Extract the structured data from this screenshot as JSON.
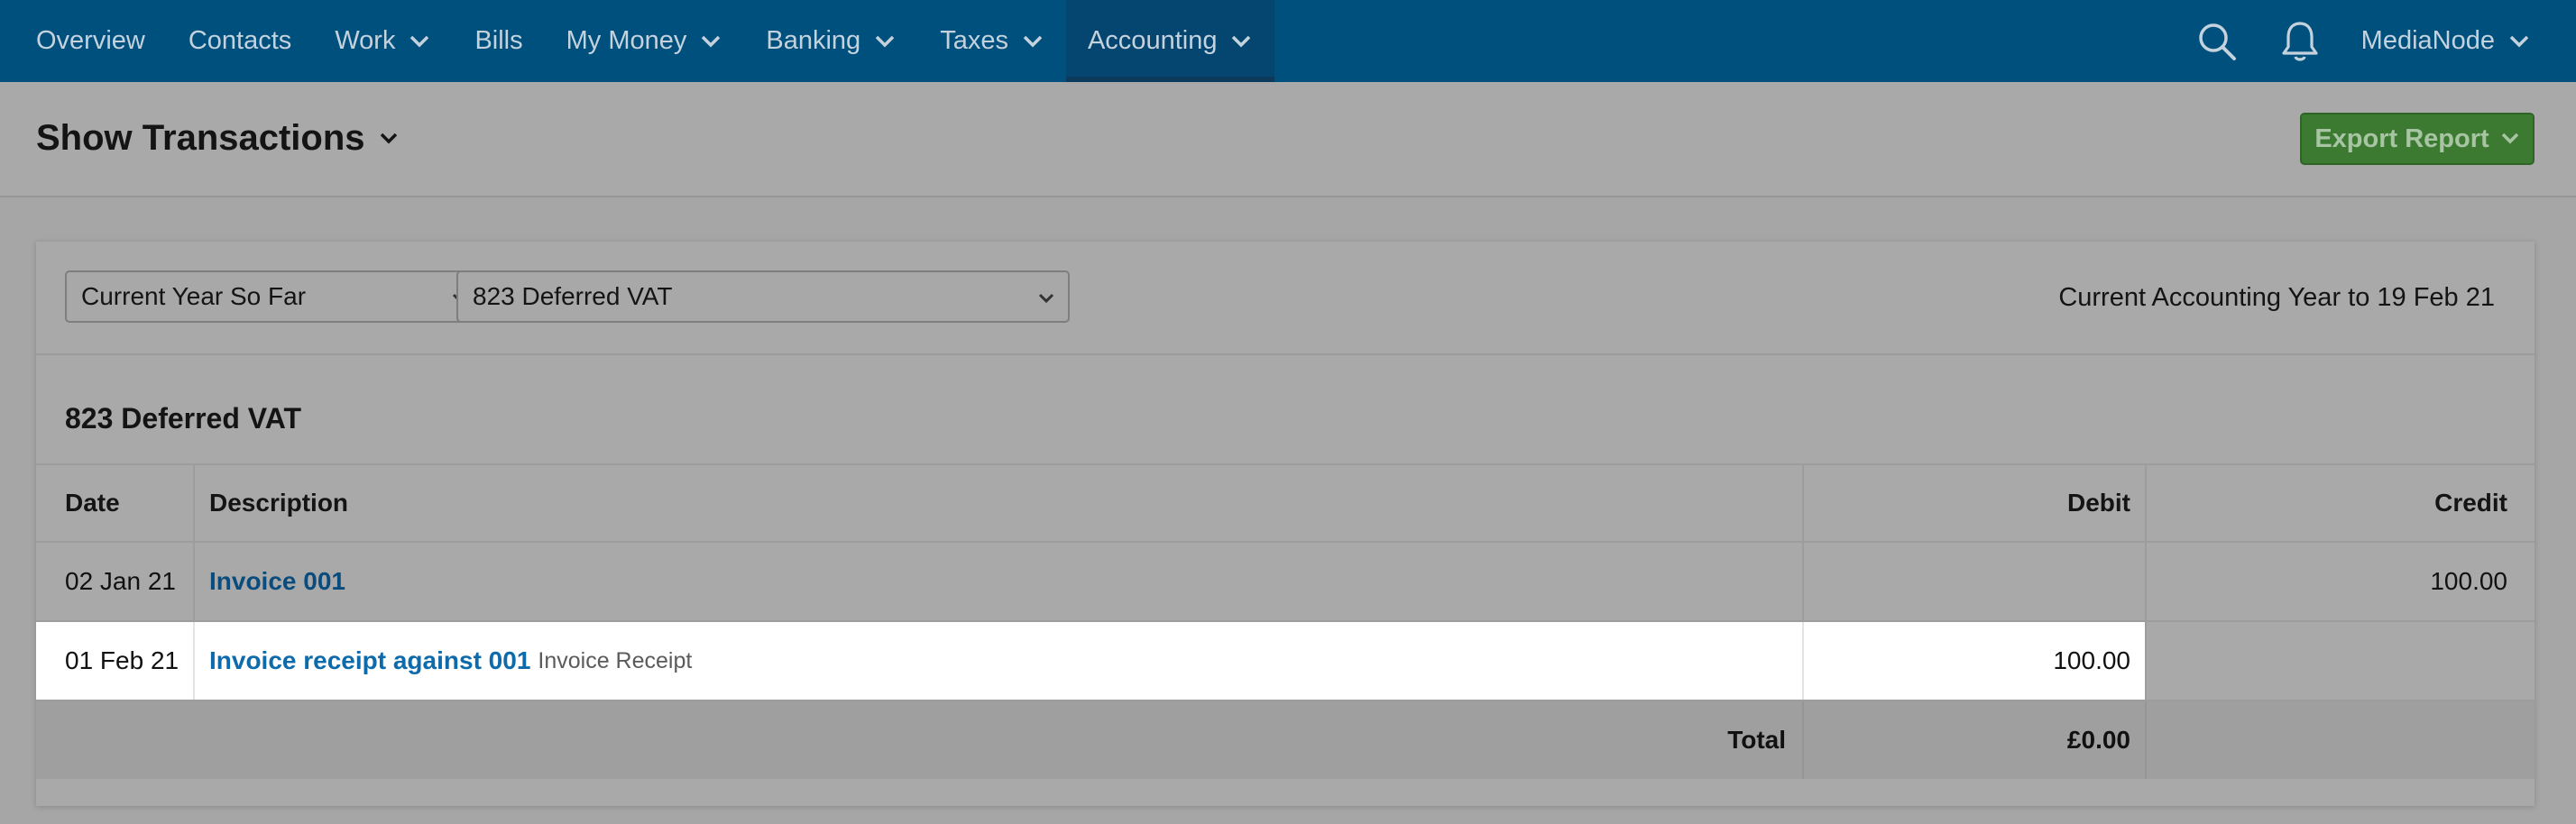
{
  "nav": {
    "items": [
      {
        "label": "Overview",
        "dropdown": false
      },
      {
        "label": "Contacts",
        "dropdown": false
      },
      {
        "label": "Work",
        "dropdown": true
      },
      {
        "label": "Bills",
        "dropdown": false
      },
      {
        "label": "My Money",
        "dropdown": true
      },
      {
        "label": "Banking",
        "dropdown": true
      },
      {
        "label": "Taxes",
        "dropdown": true
      },
      {
        "label": "Accounting",
        "dropdown": true,
        "active": true
      }
    ],
    "search_icon": "search-icon",
    "notifications_icon": "bell-icon",
    "account_name": "MediaNode"
  },
  "page": {
    "title": "Show Transactions",
    "export_label": "Export Report"
  },
  "filters": {
    "period_value": "Current Year So Far",
    "account_value": "823 Deferred VAT",
    "period_label": "Current Accounting Year to 19 Feb 21"
  },
  "report": {
    "account_heading": "823 Deferred VAT",
    "columns": {
      "date": "Date",
      "description": "Description",
      "debit": "Debit",
      "credit": "Credit"
    },
    "rows": [
      {
        "date": "02 Jan 21",
        "description": "Invoice 001",
        "type": "",
        "debit": "",
        "credit": "100.00"
      },
      {
        "date": "01 Feb 21",
        "description": "Invoice receipt against 001",
        "type": "Invoice Receipt",
        "debit": "100.00",
        "credit": ""
      }
    ],
    "total_label": "Total",
    "total_value": "£0.00"
  },
  "colors": {
    "nav_bg": "#00507e",
    "export_bg": "#3c7a32",
    "link": "#0a4c7d"
  }
}
